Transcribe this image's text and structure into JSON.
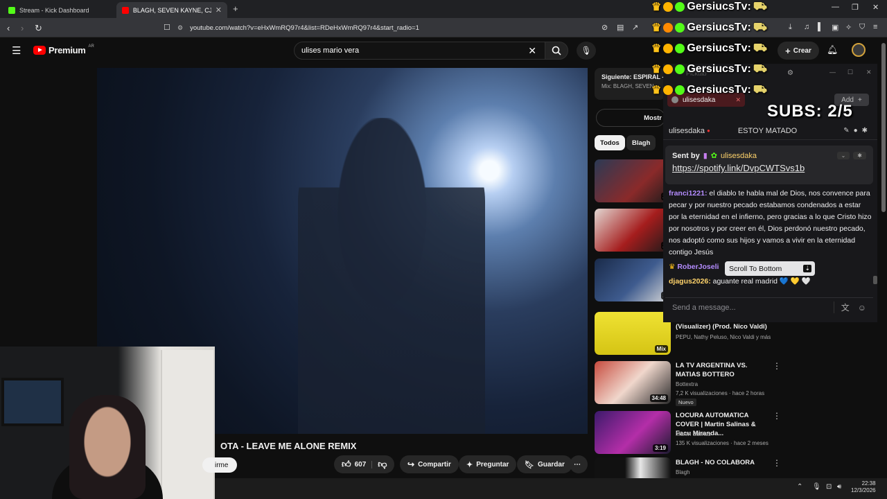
{
  "browser": {
    "tabs": [
      {
        "label": "Stream - Kick Dashboard",
        "favicon": "kick-icon",
        "color": "#53fc18"
      },
      {
        "label": "BLAGH, SEVEN KAYNE, CJOTA - L",
        "favicon": "youtube-icon",
        "color": "#ff0000"
      }
    ],
    "url": "youtube.com/watch?v=eHxWmRQ97r4&list=RDeHxWmRQ97r4&start_radio=1"
  },
  "youtube": {
    "logo_text": "Premium",
    "region": "AR",
    "search_value": "ulises mario vera",
    "create_label": "Crear",
    "video_title": "OTA - LEAVE ME ALONE REMIX",
    "subscribe_label": "irme",
    "likes": "607",
    "share_label": "Compartir",
    "ask_label": "Preguntar",
    "save_label": "Guardar",
    "next_label": "Siguiente: ESPIRAL -",
    "next_sub": "Mix: BLAGH, SEVEN",
    "show_more": "Mostr",
    "chips": [
      "Todos",
      "Blagh"
    ],
    "recs": [
      {
        "title": "(Visualizer) (Prod. Nico Valdi)",
        "channel": "PEPU, Nathy Peluso, Nico Valdi y más",
        "meta": "",
        "dur": "Mix",
        "badge": "",
        "color": "#e0d21e"
      },
      {
        "title": "LA TV ARGENTINA VS. MATIAS BOTTERO",
        "channel": "Bottextra",
        "meta": "7,2 K visualizaciones · hace 2 horas",
        "dur": "34:48",
        "badge": "Nuevo",
        "color": "#c9463d"
      },
      {
        "title": "LOCURA AUTOMATICA COVER | Martin Salinas & Facu Miranda...",
        "channel": "Martin Salinas",
        "meta": "135 K visualizaciones · hace 2 meses",
        "dur": "3:19",
        "badge": "",
        "color": "#7b2fa8"
      },
      {
        "title": "BLAGH - NO COLABORA",
        "channel": "Blagh",
        "meta": "",
        "dur": "",
        "badge": "",
        "color": "#e7e7e7"
      }
    ],
    "thumb_durs": [
      "2",
      "2",
      "2"
    ]
  },
  "kick": {
    "alert_name": "GersiucsTv:",
    "subs_text": "SUBS: 2/5",
    "channel_chip": "ulisesdaka",
    "add_label": "Add",
    "chat_user": "ulisesdaka",
    "chat_title": "ESTOY MATADO",
    "pinned_sent_by": "Sent by",
    "pinned_user": "ulisesdaka",
    "pinned_link": "https://spotify.link/DvpCWTSvs1b",
    "messages": [
      {
        "user": "franci1221:",
        "text": " el diablo te habla mal de Dios, nos convence para pecar y por nuestro pecado estabamos condenados a estar por la eternidad en el infierno, pero gracias a lo que Cristo hizo por nosotros y por creer en él, Dios perdonó nuestro pecado, nos adoptó como sus hijos y vamos a vivir en la eternidad contigo Jesús",
        "color": "#b48cff"
      },
      {
        "user": "RoberJoseli",
        "text": "",
        "color": "#b48cff"
      },
      {
        "user": "djagus2026:",
        "text": " aguante real madrid 💙 💛 🤍",
        "color": "#ffd36b"
      }
    ],
    "scroll_label": "Scroll To Bottom",
    "send_placeholder": "Send a message...",
    "ghost_title": "Picktab"
  },
  "taskbar": {
    "time": "22:38",
    "date": "12/3/2026"
  }
}
